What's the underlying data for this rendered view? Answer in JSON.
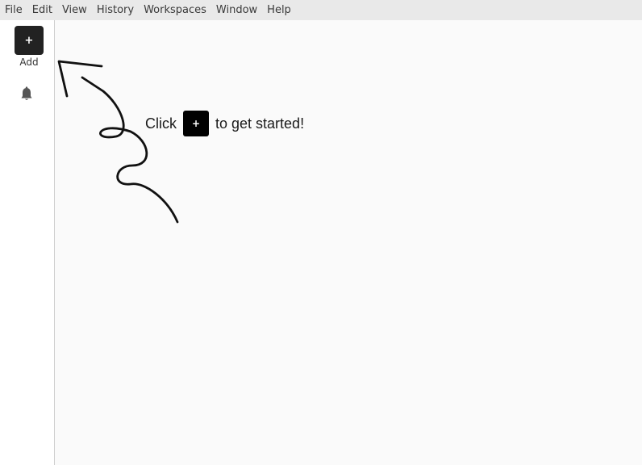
{
  "menubar": {
    "items": [
      "File",
      "Edit",
      "View",
      "History",
      "Workspaces",
      "Window",
      "Help"
    ]
  },
  "sidebar": {
    "add_button_symbol": "+",
    "add_label": "Add",
    "notification_icon": "bell-icon"
  },
  "main": {
    "hint_before": "Click",
    "hint_button_symbol": "+",
    "hint_after": "to get started!",
    "arrow_icon": "curly-arrow-icon"
  },
  "colors": {
    "menubar_bg": "#e9e9e9",
    "sidebar_bg": "#ffffff",
    "canvas_bg": "#fafafa",
    "button_bg": "#222222"
  }
}
